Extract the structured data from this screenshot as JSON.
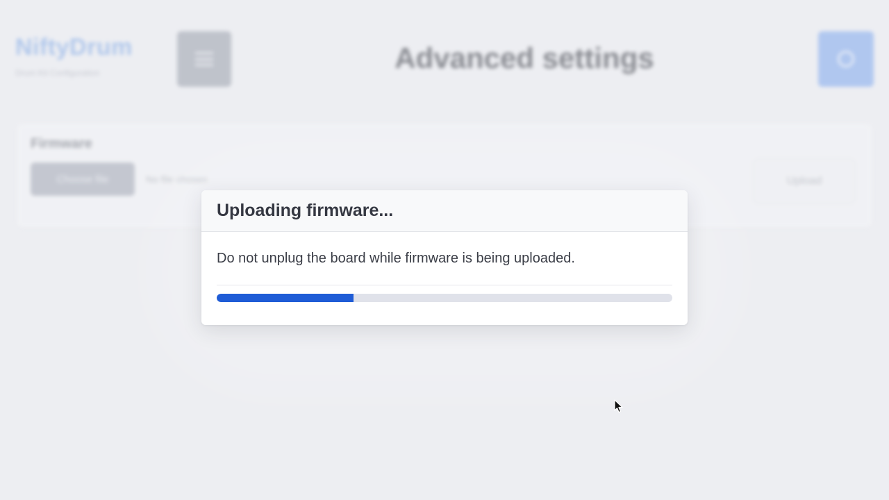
{
  "background": {
    "logo_title": "NiftyDrum",
    "logo_subtitle": "Drum Kit Configuration",
    "menu_icon": "hamburger-menu-icon",
    "page_heading": "Advanced settings",
    "help_icon": "help-icon",
    "firmware_card": {
      "title": "Firmware",
      "choose_label": "Choose file",
      "file_label": "No file chosen",
      "upload_label": "Upload"
    }
  },
  "modal": {
    "title": "Uploading firmware...",
    "message": "Do not unplug the board while firmware is being uploaded.",
    "progress_percent": 30
  },
  "colors": {
    "accent": "#1f5cd6",
    "track": "#e0e2ea",
    "page_bg": "#edeef2"
  }
}
